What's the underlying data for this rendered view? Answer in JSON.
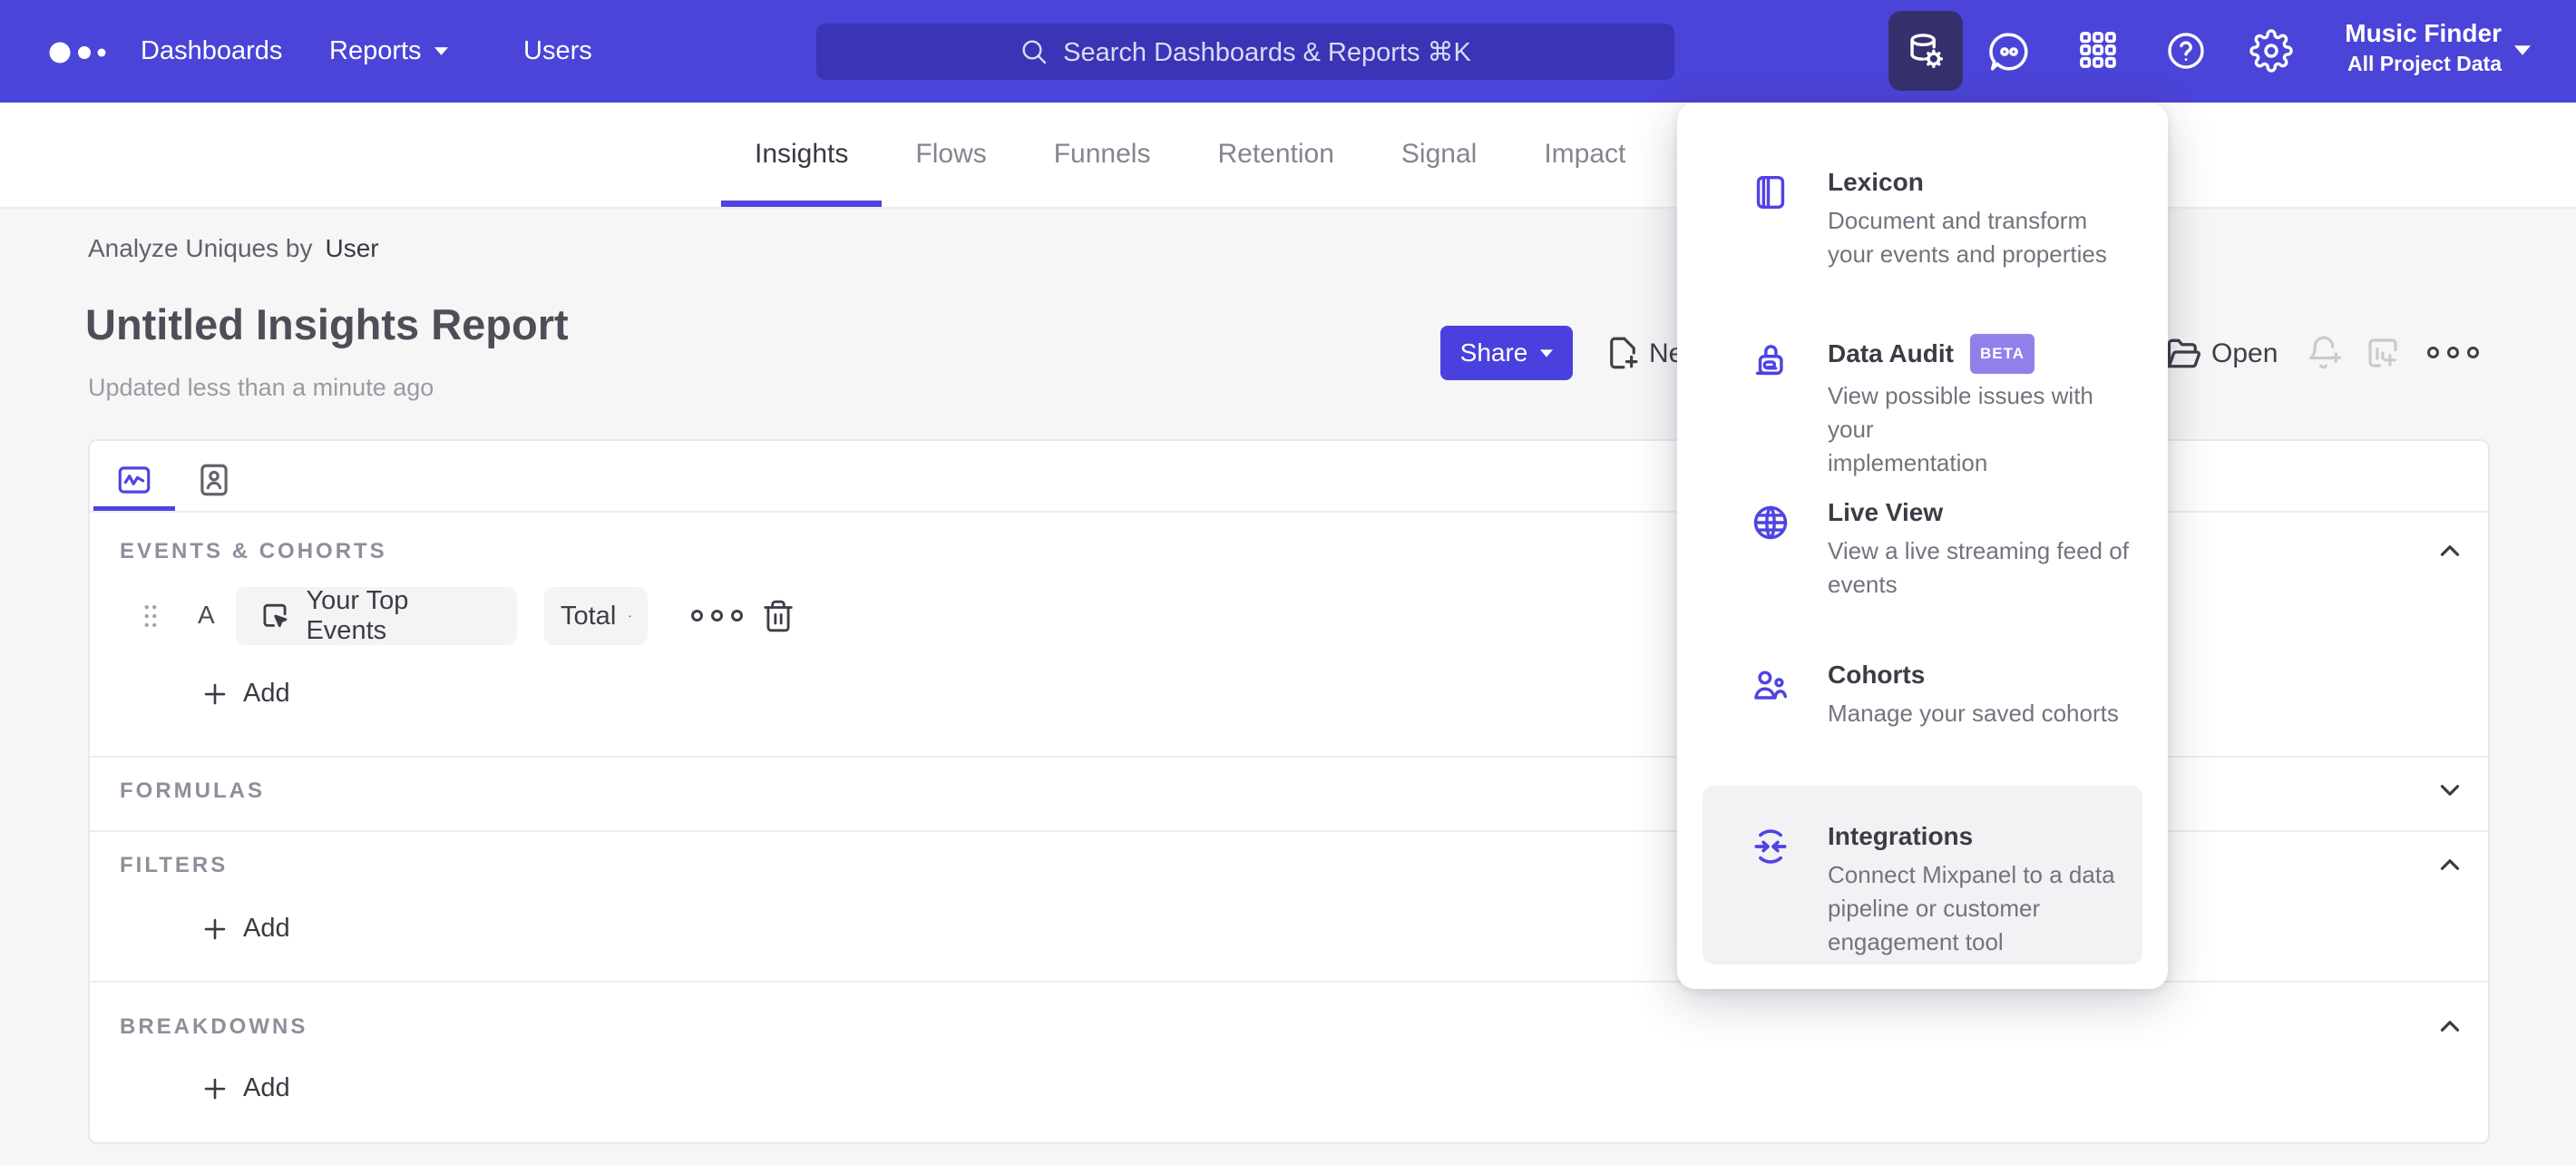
{
  "topnav": {
    "links": [
      {
        "label": "Dashboards"
      },
      {
        "label": "Reports",
        "has_caret": true
      },
      {
        "label": "Users"
      }
    ],
    "search_placeholder": "Search Dashboards & Reports ⌘K",
    "right_icons": [
      "data-management-icon",
      "feedback-icon",
      "apps-grid-icon",
      "help-icon",
      "settings-icon"
    ],
    "project": {
      "name": "Music Finder",
      "scope": "All Project Data"
    }
  },
  "report_tabs": {
    "active": "Insights",
    "items": [
      {
        "label": "Insights"
      },
      {
        "label": "Flows"
      },
      {
        "label": "Funnels"
      },
      {
        "label": "Retention"
      },
      {
        "label": "Signal"
      },
      {
        "label": "Impact"
      }
    ]
  },
  "header": {
    "breadcrumb_prefix": "Analyze Uniques by",
    "breadcrumb_value": "User",
    "title": "Untitled Insights Report",
    "updated": "Updated less than a minute ago"
  },
  "actions": {
    "share": "Share",
    "new": "New",
    "open": "Open",
    "disabled_icons": [
      "bell-plus-icon",
      "report-add-icon"
    ],
    "more_icon": "ellipsis-icon"
  },
  "builder": {
    "view_tabs": [
      "insights-chart-tab",
      "profiles-tab"
    ],
    "events": {
      "header": "EVENTS & COHORTS",
      "row": {
        "letter": "A",
        "event": "Your Top Events",
        "metric": "Total"
      },
      "add": "Add"
    },
    "formulas": {
      "header": "FORMULAS"
    },
    "filters": {
      "header": "FILTERS",
      "add": "Add"
    },
    "breakdowns": {
      "header": "BREAKDOWNS",
      "add": "Add"
    }
  },
  "menu": {
    "items": [
      {
        "title": "Lexicon",
        "desc": "Document and transform\nyour events and properties"
      },
      {
        "title": "Data Audit",
        "badge": "BETA",
        "desc": "View possible issues with your\nimplementation"
      },
      {
        "title": "Live View",
        "desc": "View a live streaming feed of\nevents"
      },
      {
        "title": "Cohorts",
        "desc": "Manage your saved cohorts"
      },
      {
        "title": "Integrations",
        "desc": "Connect Mixpanel to a data\npipeline or customer\nengagement tool",
        "highlighted": true
      }
    ]
  },
  "colors": {
    "accent": "#4f44e0",
    "nav_bg": "#4b44d8",
    "nav_active_tile": "#36316c",
    "beta_badge": "#9081ea",
    "page_bg": "#f6f6f7",
    "dark_text": "#3c3c46",
    "muted_text": "#73737f"
  }
}
